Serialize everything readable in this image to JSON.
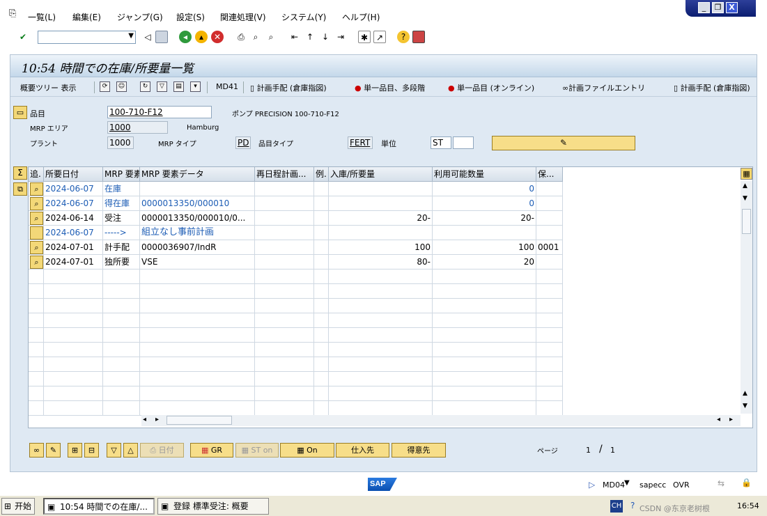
{
  "menu": {
    "items": [
      "一覧(L)",
      "編集(E)",
      "ジャンプ(G)",
      "設定(S)",
      "関連処理(V)",
      "システム(Y)",
      "ヘルプ(H)"
    ]
  },
  "window_controls": {
    "minimize": "_",
    "restore": "❐",
    "close": "X"
  },
  "screen": {
    "title": "10:54 時間での在庫/所要量一覧"
  },
  "app_toolbar": {
    "overview_tree": "概要ツリー 表示",
    "md41": "MD41",
    "plan_ord": "計画手配 (倉庫指図)",
    "single_multi": "単一品目、多段階",
    "single_online": "単一品目 (オンライン)",
    "plan_file": "計画ファイルエントリ",
    "plan_ord2": "計画手配 (倉庫指図)"
  },
  "header": {
    "material_label": "品目",
    "material_value": "100-710-F12",
    "material_desc": "ポンプ PRECISION 100-710-F12",
    "mrp_area_label": "MRP エリア",
    "mrp_area_value": "1000",
    "mrp_area_desc": "Hamburg",
    "plant_label": "プラント",
    "plant_value": "1000",
    "mrp_type_label": "MRP タイプ",
    "mrp_type_value": "PD",
    "mat_type_label": "品目タイプ",
    "mat_type_value": "FERT",
    "unit_label": "単位",
    "unit_value": "ST"
  },
  "grid": {
    "columns": [
      "追.",
      "所要日付",
      "MRP 要素",
      "MRP 要素データ",
      "再日程計画...",
      "例.",
      "入庫/所要量",
      "利用可能数量",
      "保..."
    ],
    "rows": [
      {
        "date": "2024-06-07",
        "elem": "在庫",
        "data": "",
        "resched": "",
        "ex": "",
        "qty": "",
        "avail": "0",
        "stor": "",
        "blue": true
      },
      {
        "date": "2024-06-07",
        "elem": "得在庫",
        "data": "0000013350/000010",
        "resched": "",
        "ex": "",
        "qty": "",
        "avail": "0",
        "stor": "",
        "blue": true
      },
      {
        "date": "2024-06-14",
        "elem": "受注",
        "data": "0000013350/000010/0...",
        "resched": "",
        "ex": "",
        "qty": "20-",
        "avail": "20-",
        "stor": "",
        "blue": false
      },
      {
        "date": "2024-06-07",
        "elem": "----->",
        "data": "組立なし事前計画",
        "resched": "",
        "ex": "",
        "qty": "",
        "avail": "",
        "stor": "",
        "blue": true
      },
      {
        "date": "2024-07-01",
        "elem": "計手配",
        "data": "0000036907/IndR",
        "resched": "",
        "ex": "",
        "qty": "100",
        "avail": "100",
        "stor": "0001",
        "blue": false
      },
      {
        "date": "2024-07-01",
        "elem": "独所要",
        "data": "VSE",
        "resched": "",
        "ex": "",
        "qty": "80-",
        "avail": "20",
        "stor": "",
        "blue": false
      }
    ]
  },
  "bottom_buttons": {
    "date": "日付",
    "gr": "GR",
    "st_on": "ST on",
    "on": "On",
    "vendor": "仕入先",
    "customer": "得意先",
    "page_label": "ページ",
    "page_current": "1",
    "page_sep": "/",
    "page_total": "1"
  },
  "status": {
    "tcode": "MD04",
    "server": "sapecc",
    "mode": "OVR",
    "logo": "SAP"
  },
  "taskbar": {
    "start": "开始",
    "task1": "10:54 時間での在庫/...",
    "task2": "登録 標準受注: 概要",
    "lang": "CH",
    "clock": "16:54",
    "watermark": "CSDN @东京老树根"
  }
}
